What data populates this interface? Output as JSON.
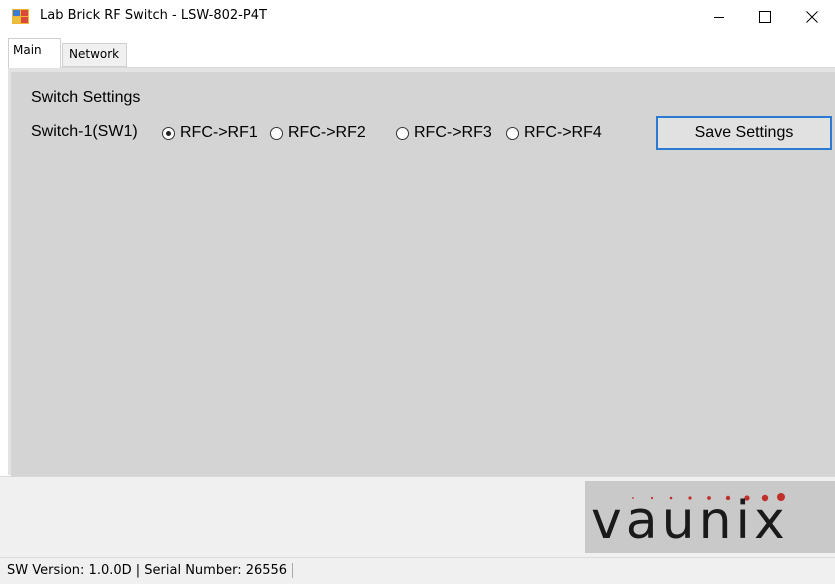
{
  "window": {
    "title": "Lab Brick RF Switch - LSW-802-P4T",
    "icon": "app-window-icon",
    "minimize_icon": "minimize-icon",
    "maximize_icon": "maximize-icon",
    "close_icon": "close-icon"
  },
  "tabs": [
    {
      "label": "Main",
      "selected": true
    },
    {
      "label": "Network",
      "selected": false
    }
  ],
  "switch_settings": {
    "title": "Switch Settings",
    "switch_label": "Switch-1(SW1)",
    "options": [
      {
        "label": "RFC->RF1",
        "checked": true
      },
      {
        "label": "RFC->RF2",
        "checked": false
      },
      {
        "label": "RFC->RF3",
        "checked": false
      },
      {
        "label": "RFC->RF4",
        "checked": false
      }
    ],
    "save_label": "Save Settings"
  },
  "logo": {
    "text": "vaunix",
    "dot_color": "#c0302a",
    "text_color": "#1a1a1a"
  },
  "status": {
    "text": "SW Version: 1.0.0D | Serial Number: 26556"
  },
  "colors": {
    "panel": "#d4d4d4",
    "button_border": "#2a7ad2",
    "logo_bg": "#c9c9c9"
  }
}
